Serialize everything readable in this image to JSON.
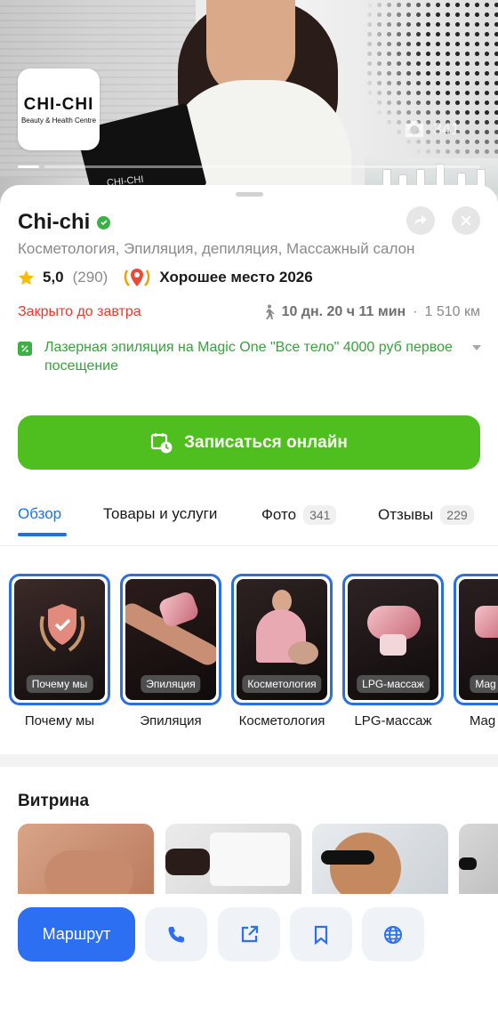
{
  "hero": {
    "logo_main": "CHI-CHI",
    "logo_sub": "Beauty & Health Centre",
    "photo_count": "341",
    "card_text": "CHI-CHI"
  },
  "org": {
    "name": "Chi-chi",
    "categories": "Косметология, Эпиляция, депиляция, Массажный салон",
    "rating": "5,0",
    "reviews_count": "(290)",
    "award": "Хорошее место 2026",
    "status": "Закрыто до завтра",
    "travel_time": "10 дн. 20 ч 11 мин",
    "travel_separator": "·",
    "distance": "1 510 км"
  },
  "promo": {
    "text": "Лазерная эпиляция на Magic One \"Все тело\" 4000 руб первое посещение"
  },
  "actions": {
    "book_label": "Записаться онлайн",
    "route_label": "Маршрут"
  },
  "tabs": [
    {
      "label": "Обзор",
      "badge": ""
    },
    {
      "label": "Товары и услуги",
      "badge": ""
    },
    {
      "label": "Фото",
      "badge": "341"
    },
    {
      "label": "Отзывы",
      "badge": "229"
    }
  ],
  "stories": [
    {
      "chip": "Почему мы",
      "label": "Почему мы"
    },
    {
      "chip": "Эпиляция",
      "label": "Эпиляция"
    },
    {
      "chip": "Косметология",
      "label": "Косметология"
    },
    {
      "chip": "LPG-массаж",
      "label": "LPG-массаж"
    },
    {
      "chip": "Mag",
      "label": "Mag"
    }
  ],
  "showcase": {
    "title": "Витрина"
  },
  "colors": {
    "accent_blue": "#2c6ff2",
    "book_green": "#4fbf1f",
    "closed_red": "#e83a2f",
    "promo_green": "#3aa03f"
  },
  "icons": [
    "camera-icon",
    "verified-icon",
    "share-icon",
    "close-icon",
    "star-icon",
    "award-icon",
    "walk-icon",
    "discount-icon",
    "chevron-down-icon",
    "calendar-clock-icon",
    "phone-icon",
    "share-external-icon",
    "bookmark-icon",
    "globe-icon"
  ]
}
